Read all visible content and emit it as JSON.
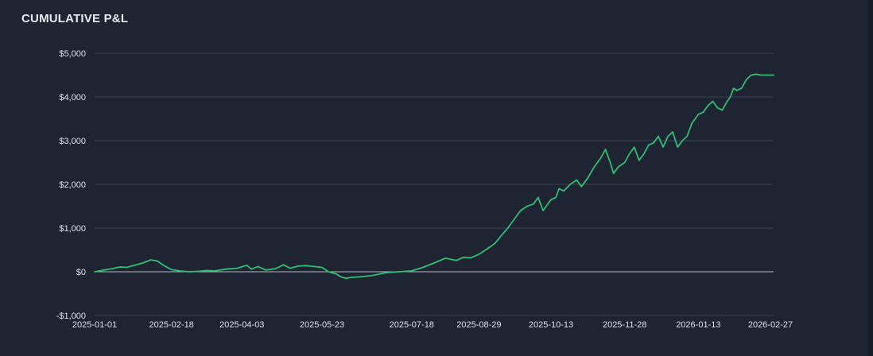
{
  "colors": {
    "background": "#1f2433",
    "grid": "#3b4150",
    "zero_line": "#b4b8c2",
    "line": "#2fbf71",
    "text": "#dde1e8"
  },
  "chart_data": {
    "type": "line",
    "title": "CUMULATIVE P&L",
    "xlabel": "",
    "ylabel": "",
    "ylim": [
      -1000,
      5000
    ],
    "xlim": [
      "2025-01-01",
      "2026-03-01"
    ],
    "grid": true,
    "legend": "none",
    "y_ticks": [
      -1000,
      0,
      1000,
      2000,
      3000,
      4000,
      5000
    ],
    "y_tick_labels": [
      "-$1,000",
      "$0",
      "$1,000",
      "$2,000",
      "$3,000",
      "$4,000",
      "$5,000"
    ],
    "x_ticks": [
      "2025-01-01",
      "2025-02-18",
      "2025-04-03",
      "2025-05-23",
      "2025-07-18",
      "2025-08-29",
      "2025-10-13",
      "2025-11-28",
      "2026-01-13",
      "2026-02-27"
    ],
    "series": [
      {
        "x": [
          "2025-01-01",
          "2025-01-07",
          "2025-01-12",
          "2025-01-17",
          "2025-01-21",
          "2025-01-26",
          "2025-01-31",
          "2025-02-05",
          "2025-02-09",
          "2025-02-13",
          "2025-02-18",
          "2025-02-23",
          "2025-03-01",
          "2025-03-07",
          "2025-03-12",
          "2025-03-17",
          "2025-03-24",
          "2025-03-31",
          "2025-04-06",
          "2025-04-09",
          "2025-04-13",
          "2025-04-18",
          "2025-04-24",
          "2025-04-29",
          "2025-05-03",
          "2025-05-08",
          "2025-05-13",
          "2025-05-18",
          "2025-05-23",
          "2025-05-27",
          "2025-06-01",
          "2025-06-04",
          "2025-06-07",
          "2025-06-10",
          "2025-06-14",
          "2025-06-23",
          "2025-07-02",
          "2025-07-10",
          "2025-07-18",
          "2025-07-25",
          "2025-08-01",
          "2025-08-08",
          "2025-08-15",
          "2025-08-19",
          "2025-08-24",
          "2025-08-29",
          "2025-09-03",
          "2025-09-08",
          "2025-09-12",
          "2025-09-16",
          "2025-09-20",
          "2025-09-24",
          "2025-09-28",
          "2025-10-02",
          "2025-10-05",
          "2025-10-08",
          "2025-10-10",
          "2025-10-13",
          "2025-10-16",
          "2025-10-18",
          "2025-10-21",
          "2025-10-25",
          "2025-10-29",
          "2025-11-01",
          "2025-11-05",
          "2025-11-09",
          "2025-11-13",
          "2025-11-16",
          "2025-11-19",
          "2025-11-21",
          "2025-11-24",
          "2025-11-28",
          "2025-12-01",
          "2025-12-04",
          "2025-12-07",
          "2025-12-10",
          "2025-12-13",
          "2025-12-16",
          "2025-12-19",
          "2025-12-22",
          "2025-12-25",
          "2025-12-28",
          "2025-12-31",
          "2026-01-03",
          "2026-01-06",
          "2026-01-09",
          "2026-01-13",
          "2026-01-16",
          "2026-01-19",
          "2026-01-22",
          "2026-01-25",
          "2026-01-28",
          "2026-01-31",
          "2026-02-02",
          "2026-02-04",
          "2026-02-06",
          "2026-02-09",
          "2026-02-12",
          "2026-02-15",
          "2026-02-18",
          "2026-02-21",
          "2026-02-24",
          "2026-02-27",
          "2026-03-01"
        ],
        "values": [
          0,
          40,
          70,
          110,
          100,
          150,
          200,
          270,
          250,
          150,
          50,
          20,
          0,
          10,
          30,
          20,
          60,
          80,
          150,
          60,
          120,
          40,
          70,
          160,
          80,
          130,
          140,
          120,
          100,
          0,
          -50,
          -120,
          -150,
          -130,
          -120,
          -90,
          -20,
          0,
          20,
          100,
          200,
          310,
          260,
          330,
          320,
          400,
          520,
          650,
          830,
          1000,
          1200,
          1400,
          1500,
          1550,
          1700,
          1400,
          1500,
          1650,
          1700,
          1900,
          1850,
          2000,
          2100,
          1950,
          2150,
          2400,
          2600,
          2800,
          2500,
          2250,
          2400,
          2500,
          2700,
          2850,
          2550,
          2700,
          2900,
          2950,
          3100,
          2850,
          3100,
          3200,
          2850,
          3000,
          3100,
          3400,
          3600,
          3650,
          3800,
          3900,
          3750,
          3700,
          3900,
          4000,
          4200,
          4150,
          4200,
          4400,
          4500,
          4520,
          4500,
          4500,
          4500,
          4500
        ]
      }
    ]
  }
}
